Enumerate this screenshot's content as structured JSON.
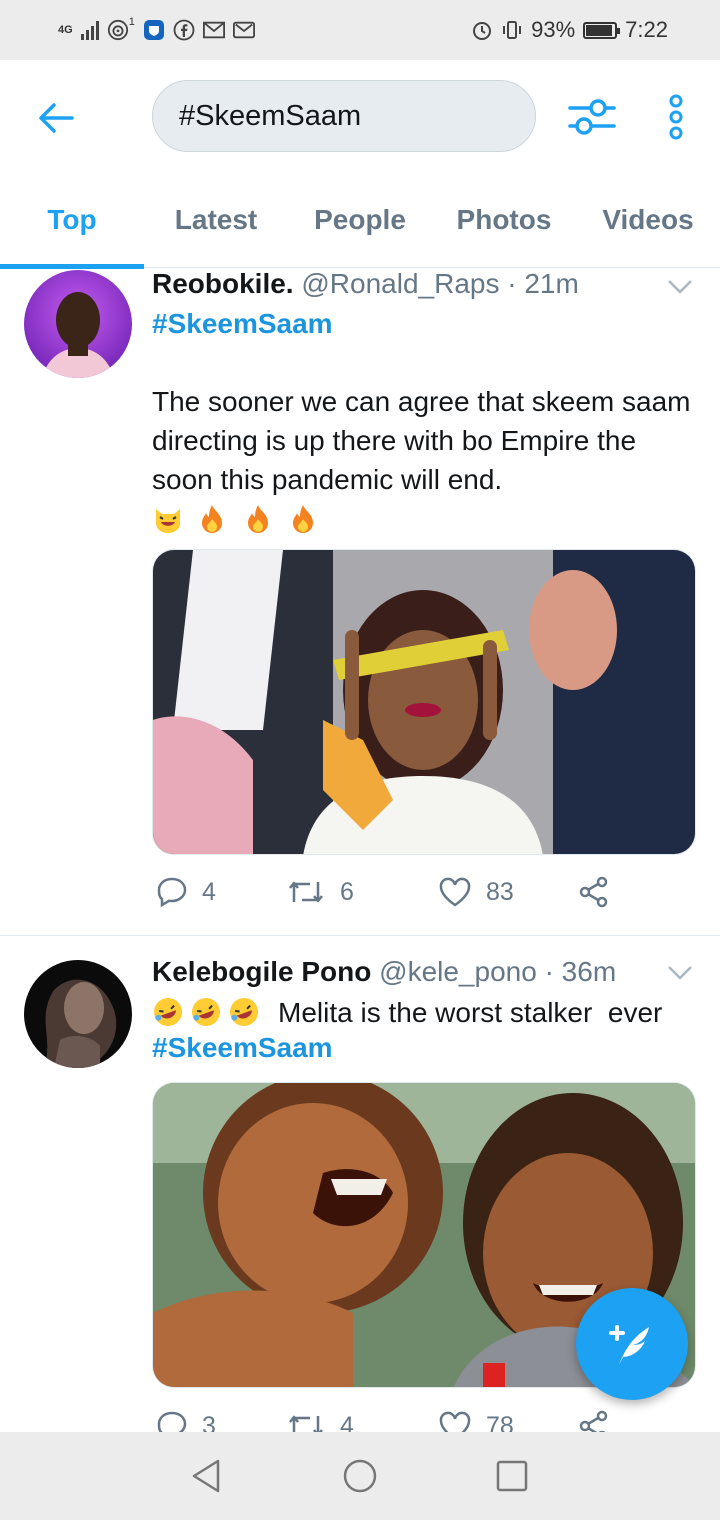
{
  "status_bar": {
    "network": "4G",
    "sim_badge": "1",
    "battery": "93%",
    "battery_level": 0.93,
    "time": "7:22",
    "icons": [
      "signal-icon",
      "hotspot-icon",
      "app-notification-icon",
      "facebook-icon",
      "gmail-icon",
      "mail-icon",
      "alarm-icon",
      "vibrate-icon",
      "battery-icon"
    ]
  },
  "header": {
    "search_query": "#SkeemSaam",
    "back_icon": "arrow-left-icon",
    "filter_icon": "sliders-icon",
    "more_icon": "more-vertical-icon"
  },
  "tabs": [
    {
      "label": "Top",
      "active": true
    },
    {
      "label": "Latest",
      "active": false
    },
    {
      "label": "People",
      "active": false
    },
    {
      "label": "Photos",
      "active": false
    },
    {
      "label": "Videos",
      "active": false
    }
  ],
  "tweets": [
    {
      "name": "Reobokile.",
      "handle": "@Ronald_Raps",
      "time": "· 21m",
      "hashtag": "#SkeemSaam",
      "text": "The sooner we can agree that skeem saam directing is up there with bo Empire the soon this pandemic will end.",
      "emojis": [
        "😹",
        "🔥",
        "🔥",
        "🔥"
      ],
      "replies": "4",
      "retweets": "6",
      "likes": "83"
    },
    {
      "name": "Kelebogile Pono",
      "handle": "@kele_pono",
      "time": "· 36m",
      "emojis": [
        "🤣",
        "🤣",
        "🤣"
      ],
      "text": "Melita is the worst stalker  ever",
      "hashtag": "#SkeemSaam",
      "replies": "3",
      "retweets": "4",
      "likes": "78"
    }
  ],
  "colors": {
    "accent": "#1da1f2",
    "hashtag": "#1b95e0",
    "secondary_text": "#657786"
  }
}
